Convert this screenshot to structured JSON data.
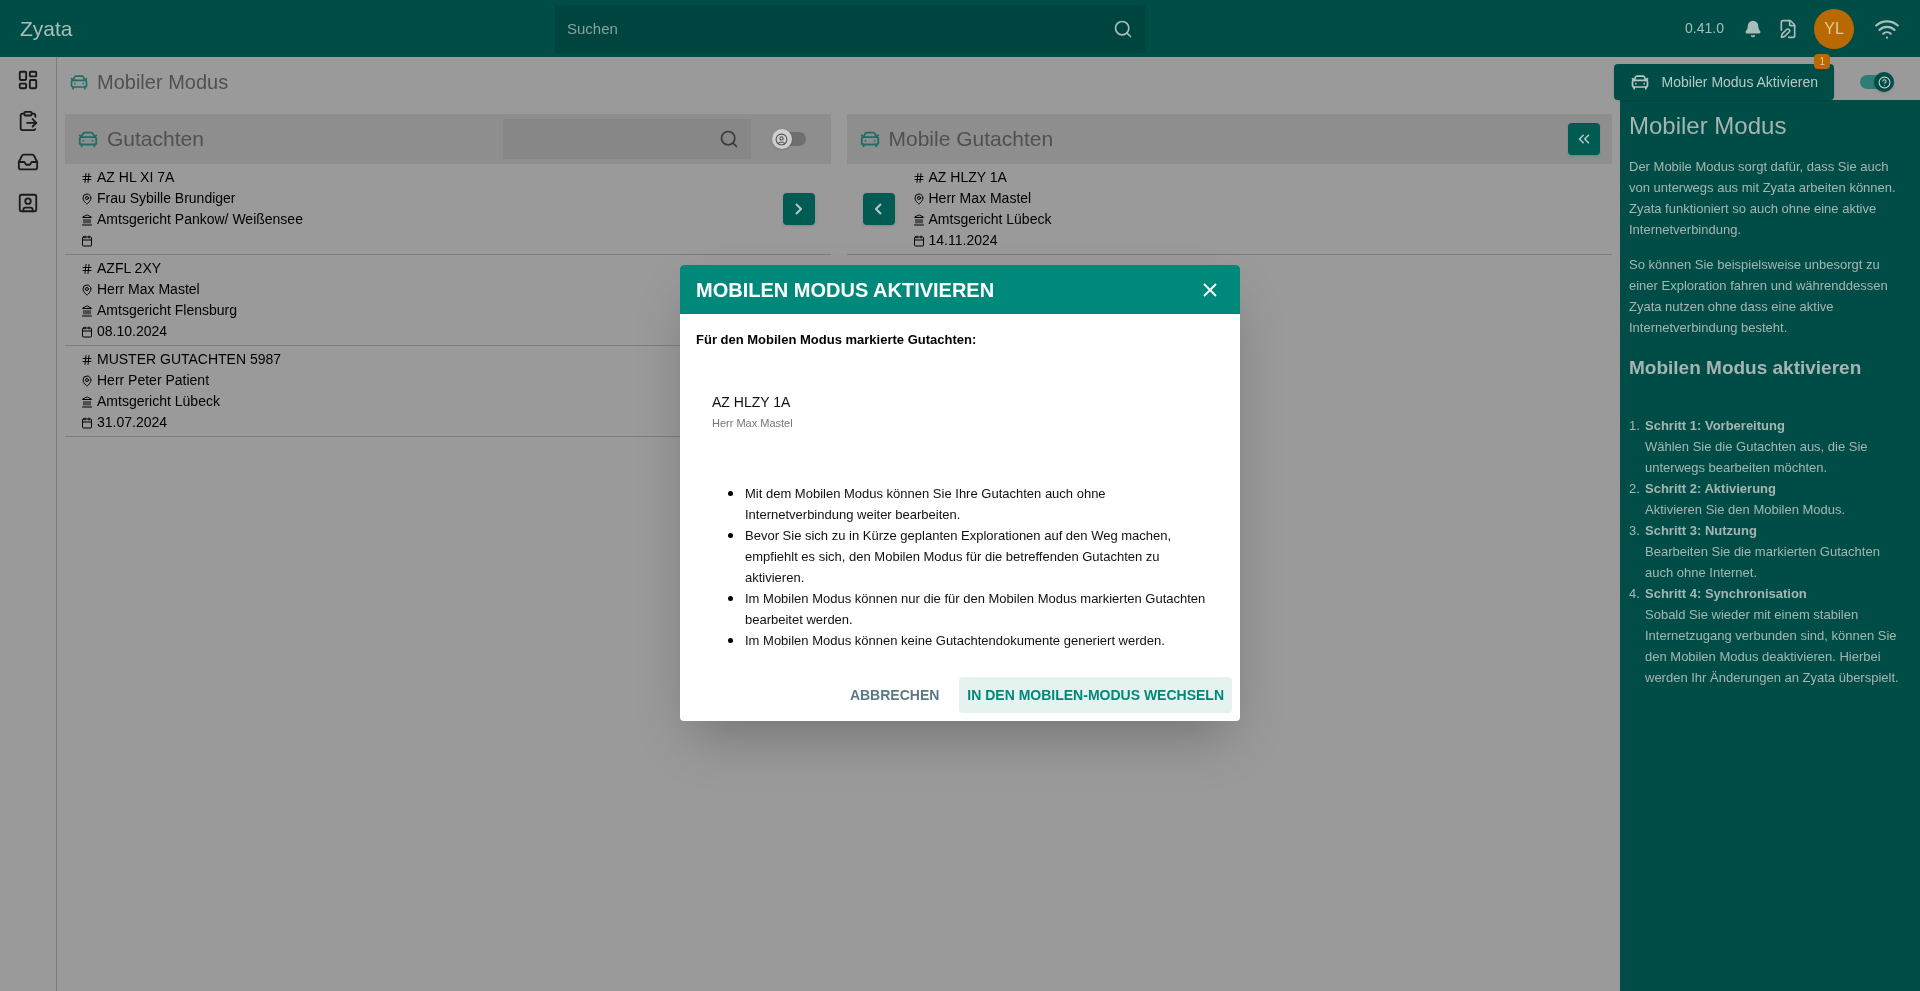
{
  "app": {
    "title": "Zyata",
    "search": {
      "placeholder": "Suchen"
    },
    "version": "0.41.0",
    "avatar": "YL"
  },
  "page": {
    "title": "Mobiler Modus",
    "activate_button": {
      "label": "Mobiler Modus Aktivieren",
      "badge": "1"
    },
    "mobile_toggle": {
      "on": true
    }
  },
  "gutachten": {
    "title": "Gutachten",
    "filter_toggle": {
      "on": false
    },
    "items": [
      {
        "az": "AZ HL XI 7A",
        "person": "Frau Sybille Brundiger",
        "court": "Amtsgericht Pankow/ Weißensee",
        "hovered": true
      },
      {
        "az": "AZFL 2XY",
        "person": "Herr Max Mastel",
        "court": "Amtsgericht Flensburg",
        "date": "08.10.2024"
      },
      {
        "az": "MUSTER GUTACHTEN 5987",
        "person": "Herr Peter Patient",
        "court": "Amtsgericht Lübeck",
        "date": "31.07.2024"
      }
    ]
  },
  "mobile_gutachten": {
    "title": "Mobile Gutachten",
    "items": [
      {
        "az": "AZ HLZY 1A",
        "person": "Herr Max Mastel",
        "court": "Amtsgericht Lübeck",
        "date": "14.11.2024",
        "hovered": true
      }
    ]
  },
  "help": {
    "title": "Mobiler Modus",
    "paragraphs": [
      "Der Mobile Modus sorgt dafür, dass Sie auch von unterwegs aus mit Zyata arbeiten können. Zyata funktioniert so auch ohne eine aktive Internetverbindung.",
      "So können Sie beispielsweise unbesorgt zu einer Exploration fahren und währenddessen Zyata nutzen ohne dass eine aktive Internetverbindung besteht."
    ],
    "subtitle": "Mobilen Modus aktivieren",
    "steps": [
      {
        "number": "1.",
        "title": "Schritt 1: Vorbereitung",
        "text": "Wählen Sie die Gutachten aus, die Sie unterwegs bearbeiten möchten."
      },
      {
        "number": "2.",
        "title": "Schritt 2: Aktivierung",
        "text": "Aktivieren Sie den Mobilen Modus."
      },
      {
        "number": "3.",
        "title": "Schritt 3: Nutzung",
        "text": "Bearbeiten Sie die markierten Gutachten auch ohne Internet."
      },
      {
        "number": "4.",
        "title": "Schritt 4: Synchronisation",
        "text": "Sobald Sie wieder mit einem stabilen Internetzugang verbunden sind, können Sie den Mobilen Modus deaktivieren. Hierbei werden Ihr Änderungen an Zyata überspielt."
      }
    ]
  },
  "dialog": {
    "title": "MOBILEN MODUS AKTIVIEREN",
    "subtitle": "Für den Mobilen Modus markierte Gutachten:",
    "marked": [
      {
        "az": "AZ HLZY 1A",
        "person": "Herr Max Mastel"
      }
    ],
    "bullets": [
      "Mit dem Mobilen Modus können Sie Ihre Gutachten auch ohne Internetverbindung weiter bearbeiten.",
      "Bevor Sie sich zu in Kürze geplanten Explorationen auf den Weg machen, empfiehlt es sich, den Mobilen Modus für die betreffenden Gutachten zu aktivieren.",
      "Im Mobilen Modus können nur die für den Mobilen Modus markierten Gutachten bearbeitet werden.",
      "Im Mobilen Modus können keine Gutachtendokumente generiert werden."
    ],
    "buttons": [
      {
        "label": "ABBRECHEN",
        "kind": "text"
      },
      {
        "label": "IN DEN MOBILEN-MODUS WECHSELN",
        "kind": "tonal"
      }
    ]
  }
}
